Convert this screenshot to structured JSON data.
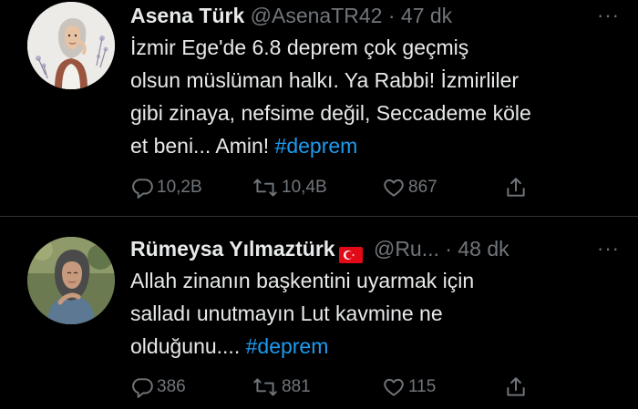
{
  "tweets": [
    {
      "author_name": "Asena Türk",
      "handle": "@AsenaTR42",
      "separator": "·",
      "time": "47 dk",
      "more": "···",
      "text_lines": [
        "İzmir Ege'de 6.8  deprem çok geçmiş",
        "olsun müslüman halkı. Ya Rabbi! İzmirliler",
        "gibi zinaya, nefsime değil, Seccademe köle",
        "et beni... Amin! "
      ],
      "hashtag": "#deprem",
      "replies": "10,2B",
      "retweets": "10,4B",
      "likes": "867",
      "avatar_icon": "profile-photo-woman-hijab"
    },
    {
      "author_name": "Rümeysa Yılmaztürk",
      "handle": "@Ru...",
      "separator": "·",
      "time": "48 dk",
      "more": "···",
      "flag_icon": "turkey-flag-icon",
      "text_lines": [
        "Allah zinanın başkentini uyarmak için",
        "salladı unutmayın Lut kavmine ne",
        "olduğunu.... "
      ],
      "hashtag": "#deprem",
      "replies": "386",
      "retweets": "881",
      "likes": "115",
      "avatar_icon": "profile-photo-woman-hijab"
    }
  ],
  "colors": {
    "background": "#000000",
    "text": "#e7e9ea",
    "muted": "#71767b",
    "link": "#1d9bf0",
    "divider": "#2f3336",
    "flag_red": "#e30a17"
  },
  "icons": {
    "reply": "reply-icon",
    "retweet": "retweet-icon",
    "like": "heart-icon",
    "share": "share-icon",
    "more": "more-icon"
  }
}
